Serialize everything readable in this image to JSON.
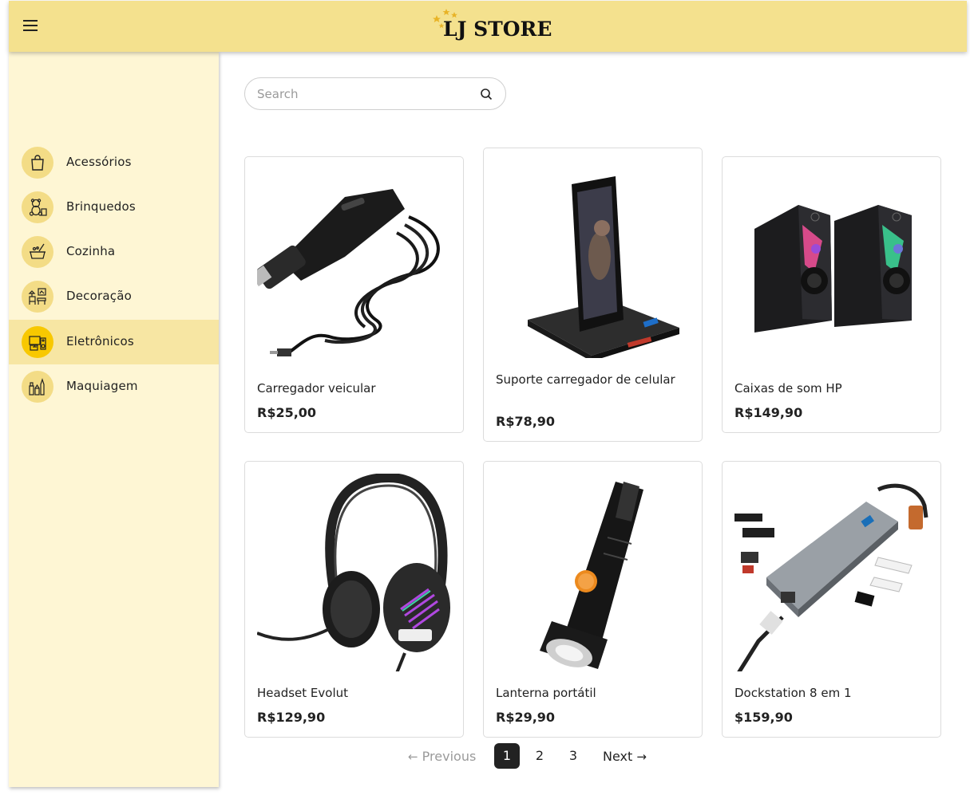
{
  "header": {
    "brand": "LJ STORE",
    "menu_icon": "hamburger-menu-icon",
    "brand_color": "#f4e18e"
  },
  "search": {
    "placeholder": "Search",
    "value": ""
  },
  "sidebar": {
    "background": "#fef6d4",
    "active_color": "#f7e6a3",
    "items": [
      {
        "label": "Acessórios",
        "icon": "shopping-bag-icon"
      },
      {
        "label": "Brinquedos",
        "icon": "teddy-bear-icon"
      },
      {
        "label": "Cozinha",
        "icon": "cooking-pot-icon"
      },
      {
        "label": "Decoração",
        "icon": "home-decor-icon"
      },
      {
        "label": "Eletrônicos",
        "icon": "electronics-icon",
        "active": true
      },
      {
        "label": "Maquiagem",
        "icon": "makeup-icon"
      }
    ]
  },
  "products": [
    {
      "name": "Carregador veicular",
      "price": "R$25,00"
    },
    {
      "name": "Suporte carregador de celular",
      "price": "R$78,90"
    },
    {
      "name": "Caixas de som HP",
      "price": "R$149,90"
    },
    {
      "name": "Headset Evolut",
      "price": "R$129,90"
    },
    {
      "name": "Lanterna portátil",
      "price": "R$29,90"
    },
    {
      "name": "Dockstation 8 em 1",
      "price": "$159,90"
    }
  ],
  "pagination": {
    "previous": "Previous",
    "next": "Next",
    "pages": [
      "1",
      "2",
      "3"
    ],
    "current": "1"
  }
}
